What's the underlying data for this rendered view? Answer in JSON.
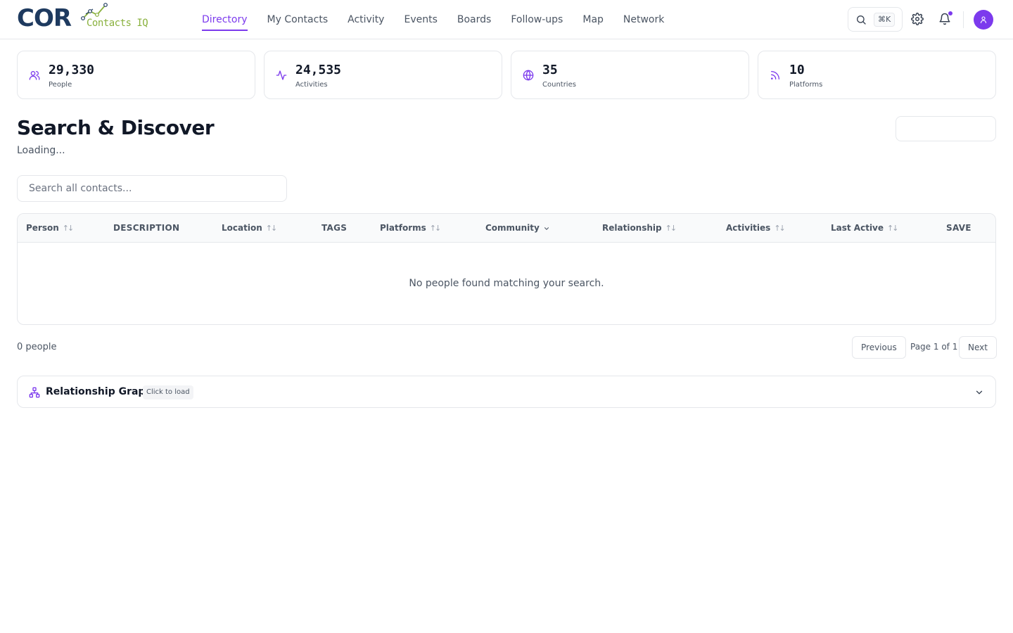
{
  "brand": {
    "name": "COR",
    "subtitle": "Contacts IQ",
    "navy": "#1e3a5f",
    "green": "#8ab13e"
  },
  "accent_color": "#7c3aed",
  "nav": {
    "items": [
      {
        "label": "Directory",
        "active": true
      },
      {
        "label": "My Contacts"
      },
      {
        "label": "Activity"
      },
      {
        "label": "Events"
      },
      {
        "label": "Boards"
      },
      {
        "label": "Follow-ups"
      },
      {
        "label": "Map"
      },
      {
        "label": "Network"
      }
    ]
  },
  "header_actions": {
    "search_icon": "search-icon",
    "shortcut": "⌘K",
    "settings_icon": "gear-icon",
    "notifications_icon": "bell-icon",
    "has_notification": true,
    "avatar_icon": "user-icon"
  },
  "stats": [
    {
      "value": "29,330",
      "label": "People",
      "icon": "users-icon"
    },
    {
      "value": "24,535",
      "label": "Activities",
      "icon": "activity-icon"
    },
    {
      "value": "35",
      "label": "Countries",
      "icon": "globe-icon"
    },
    {
      "value": "10",
      "label": "Platforms",
      "icon": "rss-icon"
    }
  ],
  "page": {
    "title": "Search & Discover",
    "status": "Loading..."
  },
  "search": {
    "placeholder": "Search all contacts...",
    "value": ""
  },
  "table": {
    "columns": [
      {
        "label": "Person",
        "sortable": true
      },
      {
        "label": "DESCRIPTION",
        "sortable": false
      },
      {
        "label": "Location",
        "sortable": true
      },
      {
        "label": "TAGS",
        "sortable": false
      },
      {
        "label": "Platforms",
        "sortable": true
      },
      {
        "label": "Community",
        "dropdown": true
      },
      {
        "label": "Relationship",
        "sortable": true
      },
      {
        "label": "Activities",
        "sortable": true
      },
      {
        "label": "Last Active",
        "sortable": true
      },
      {
        "label": "SAVE",
        "sortable": false
      }
    ],
    "rows": [],
    "empty_message": "No people found matching your search."
  },
  "pagination": {
    "count_text": "0 people",
    "previous_label": "Previous",
    "page_info": "Page 1 of 1",
    "next_label": "Next"
  },
  "graph_panel": {
    "title": "Relationship Graph",
    "badge": "Click to load",
    "icon": "network-icon",
    "toggle_icon": "chevron-down-icon"
  }
}
